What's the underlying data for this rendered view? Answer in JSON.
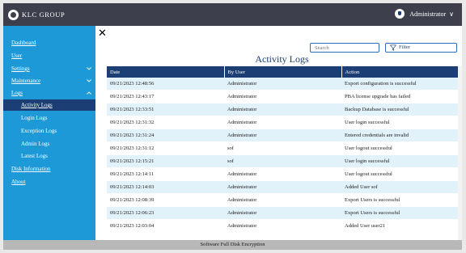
{
  "header": {
    "brand": "KLC GROUP",
    "user": "Administrator",
    "user_chevron": "∨"
  },
  "sidebar": {
    "items": [
      {
        "label": "Dashboard"
      },
      {
        "label": "User"
      },
      {
        "label": "Settings"
      },
      {
        "label": "Maintenance"
      },
      {
        "label": "Logs"
      },
      {
        "label": "Activity Logs"
      },
      {
        "label": "Login Logs"
      },
      {
        "label": "Exception Logs"
      },
      {
        "label": "Admin Logs"
      },
      {
        "label": "Latest Logs"
      },
      {
        "label": "Disk Information"
      },
      {
        "label": "About"
      }
    ]
  },
  "toolbar": {
    "close": "✕",
    "search_placeholder": "Search",
    "filter_label": "Filter"
  },
  "page": {
    "title": "Activity Logs"
  },
  "table": {
    "columns": [
      "Date",
      "By User",
      "Action"
    ],
    "rows": [
      [
        "09/21/2023 12:48:56",
        "Administrator",
        "Export configuration is successful"
      ],
      [
        "09/21/2023 12:43:17",
        "Administrator",
        "PBA license upgrade has failed"
      ],
      [
        "09/21/2023 12:33:51",
        "Administrator",
        "Backup Database is successful"
      ],
      [
        "09/21/2023 12:31:32",
        "Administrator",
        "User login successful"
      ],
      [
        "09/21/2023 12:31:24",
        "Administrator",
        "Entered credentials are invalid"
      ],
      [
        "09/21/2023 12:31:12",
        "sof",
        "User logout successful"
      ],
      [
        "09/21/2023 12:15:21",
        "sof",
        "User login successful"
      ],
      [
        "09/21/2023 12:14:11",
        "Administrator",
        "User logout successful"
      ],
      [
        "09/21/2023 12:14:03",
        "Administrator",
        "Added User sof"
      ],
      [
        "09/21/2023 12:08:39",
        "Administrator",
        "Export Users is successful"
      ],
      [
        "09/21/2023 12:06:23",
        "Administrator",
        "Export Users is successful"
      ],
      [
        "09/21/2023 12:03:04",
        "Administrator",
        "Added User user21"
      ]
    ]
  },
  "footer": {
    "text": "Software Full Disk Encryption"
  }
}
